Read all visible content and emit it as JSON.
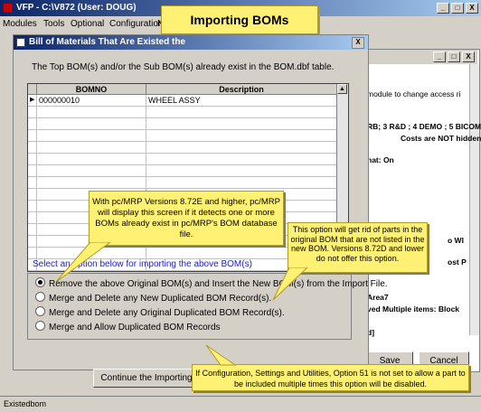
{
  "app": {
    "title": "VFP - C:\\V872 (User: DOUG)",
    "menu": [
      "Modules",
      "Tools",
      "Optional",
      "Configuration"
    ],
    "menu_trailing": "N",
    "window_buttons": [
      "_",
      "□",
      "X"
    ]
  },
  "callout_title": "Importing BOMs",
  "dialog": {
    "title": "Bill of Materials That Are Existed the",
    "close_glyph": "X",
    "message": "The Top BOM(s) and/or the Sub BOM(s) already exist in the BOM.dbf table.",
    "grid": {
      "headers": [
        "BOMNO",
        "Description"
      ],
      "rows": [
        {
          "bomno": "000000010",
          "description": "WHEEL ASSY"
        }
      ]
    },
    "select_label": "Select an option below for importing the above BOM(s)",
    "options": [
      {
        "label": "Remove the above Original BOM(s) and Insert the New BOM(s) from the Import File.",
        "selected": true
      },
      {
        "label": "Merge and Delete any New Duplicated BOM Record(s).",
        "selected": false
      },
      {
        "label": "Merge and Delete any Original Duplicated BOM Record(s).",
        "selected": false
      },
      {
        "label": "Merge and Allow Duplicated BOM Records",
        "selected": false
      }
    ],
    "continue_button": "Continue the Importing"
  },
  "background_window": {
    "lines": [
      "module to change access ri",
      "RB; 3 R&D ; 4 DEMO ; 5 BICOM",
      "Costs are NOT hidden.",
      "nat: On",
      "o WI",
      "ost P",
      "Area7",
      "ved    Multiple items: Block",
      "d]"
    ],
    "save_button": "Save",
    "cancel_button": "Cancel"
  },
  "callouts": {
    "version_note": "With pc/MRP Versions 8.72E and higher, pc/MRP will display this screen if it detects one or more BOMs already exist in pc/MRP's BOM database file.",
    "option_note": "This option will get rid of parts in the original BOM that are not listed in the new BOM.  Versions 8.72D and lower do not offer this option.",
    "config_note": "If Configuration, Settings and Utilities, Option 51 is not set to allow a part to be included multiple times this option will be disabled."
  },
  "status_bar": "Existedbom",
  "colors": {
    "title_bar": "#0a246a",
    "callout_bg": "#fff173",
    "select_label": "#2020c0"
  }
}
